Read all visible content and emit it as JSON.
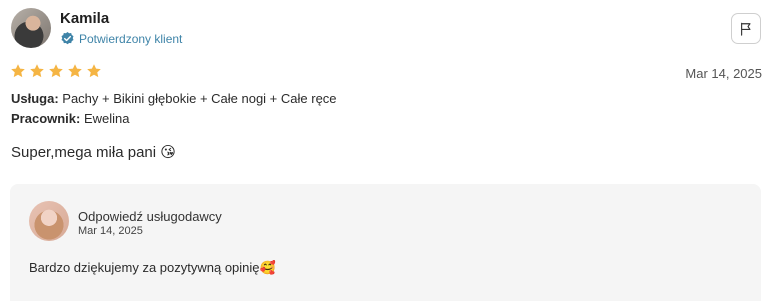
{
  "review": {
    "reviewer_name": "Kamila",
    "verified_label": "Potwierdzony klient",
    "rating": 5,
    "rating_max": 5,
    "date": "Mar 14, 2025",
    "service_label": "Usługa:",
    "service_value": " Pachy + Bikini głębokie + Całe nogi + Całe ręce",
    "employee_label": "Pracownik:",
    "employee_value": " Ewelina",
    "text": "Super,mega miła pani 😘"
  },
  "reply": {
    "title": "Odpowiedź usługodawcy",
    "date": "Mar 14, 2025",
    "text": "Bardzo dziękujemy za pozytywną opinię🥰"
  },
  "icons": {
    "verified": "verified-badge-icon",
    "flag": "flag-icon",
    "star": "star-icon"
  },
  "colors": {
    "star": "#f5b544",
    "verified": "#3f84a8",
    "reply_background": "#f5f5f5"
  }
}
